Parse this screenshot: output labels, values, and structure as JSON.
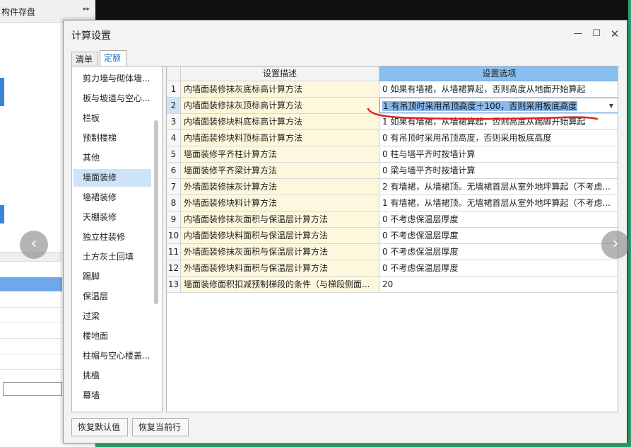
{
  "background": {
    "panel_title": "构件存盘"
  },
  "dialog": {
    "title": "计算设置",
    "tabs": [
      {
        "label": "清单",
        "active": false
      },
      {
        "label": "定额",
        "active": true
      }
    ]
  },
  "categories": [
    {
      "label": "剪力墙与砌体墙...",
      "selected": false
    },
    {
      "label": "板与坡道与空心...",
      "selected": false
    },
    {
      "label": "栏板",
      "selected": false
    },
    {
      "label": "预制楼梯",
      "selected": false
    },
    {
      "label": "其他",
      "selected": false
    },
    {
      "label": "墙面装修",
      "selected": true
    },
    {
      "label": "墙裙装修",
      "selected": false
    },
    {
      "label": "天棚装修",
      "selected": false
    },
    {
      "label": "独立柱装修",
      "selected": false
    },
    {
      "label": "土方灰土回填",
      "selected": false
    },
    {
      "label": "踢脚",
      "selected": false
    },
    {
      "label": "保温层",
      "selected": false
    },
    {
      "label": "过梁",
      "selected": false
    },
    {
      "label": "楼地面",
      "selected": false
    },
    {
      "label": "柱帽与空心楼盖...",
      "selected": false
    },
    {
      "label": "挑檐",
      "selected": false
    },
    {
      "label": "幕墙",
      "selected": false
    }
  ],
  "grid": {
    "headers": {
      "description": "设置描述",
      "option": "设置选项"
    },
    "active_row": 2,
    "rows": [
      {
        "num": "1",
        "desc": "内墙面装修抹灰底标高计算方法",
        "option": "0 如果有墙裙，从墙裙算起，否则高度从地面开始算起"
      },
      {
        "num": "2",
        "desc": "内墙面装修抹灰顶标高计算方法",
        "option": "1 有吊顶时采用吊顶高度＋100，否则采用板底高度"
      },
      {
        "num": "3",
        "desc": "内墙面装修块料底标高计算方法",
        "option": "1 如果有墙裙，从墙裙算起，否则高度从踢脚开始算起"
      },
      {
        "num": "4",
        "desc": "内墙面装修块料顶标高计算方法",
        "option": "0 有吊顶时采用吊顶高度，否则采用板底高度"
      },
      {
        "num": "5",
        "desc": "墙面装修平齐柱计算方法",
        "option": "0 柱与墙平齐时按墙计算"
      },
      {
        "num": "6",
        "desc": "墙面装修平齐梁计算方法",
        "option": "0 梁与墙平齐时按墙计算"
      },
      {
        "num": "7",
        "desc": "外墙面装修抹灰计算方法",
        "option": "2 有墙裙，从墙裙顶。无墙裙首层从室外地坪算起（不考虑..."
      },
      {
        "num": "8",
        "desc": "外墙面装修块料计算方法",
        "option": "1 有墙裙，从墙裙顶。无墙裙首层从室外地坪算起（不考虑..."
      },
      {
        "num": "9",
        "desc": "内墙面装修抹灰面积与保温层计算方法",
        "option": "0 不考虑保温层厚度"
      },
      {
        "num": "10",
        "desc": "内墙面装修块料面积与保温层计算方法",
        "option": "0 不考虑保温层厚度"
      },
      {
        "num": "11",
        "desc": "外墙面装修抹灰面积与保温层计算方法",
        "option": "0 不考虑保温层厚度"
      },
      {
        "num": "12",
        "desc": "外墙面装修块料面积与保温层计算方法",
        "option": "0 不考虑保温层厚度"
      },
      {
        "num": "13",
        "desc": "墙面装修面积扣减预制梯段的条件（与梯段侧面...",
        "option": "20"
      }
    ]
  },
  "footer": {
    "restore_default": "恢复默认值",
    "restore_row": "恢复当前行"
  },
  "icons": {
    "minimize": "minimize-icon",
    "maximize": "maximize-icon",
    "close": "close-icon",
    "dropdown": "chevron-down-icon",
    "prev": "chevron-left-icon",
    "next": "chevron-right-icon"
  },
  "colors": {
    "header_option_bg": "#86bff0",
    "desc_cell_bg": "#fdf8dd",
    "selected_category_bg": "#cfe3f8",
    "annotation_red": "#e02020"
  }
}
